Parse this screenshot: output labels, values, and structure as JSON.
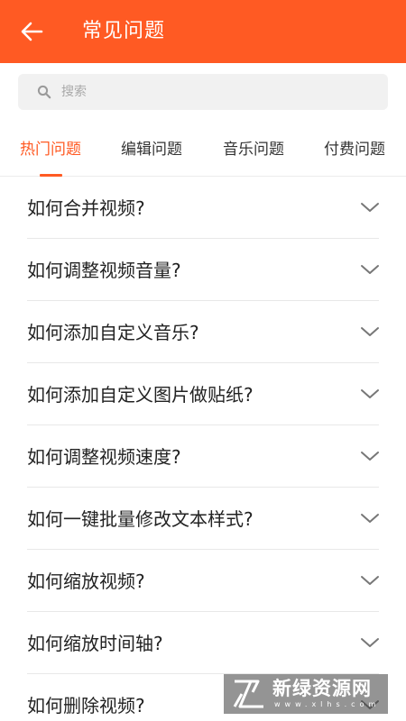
{
  "header": {
    "title": "常见问题",
    "back_icon": "arrow-left-icon",
    "background": "#ff5a23"
  },
  "search": {
    "placeholder": "搜索",
    "value": "",
    "icon": "search-icon"
  },
  "tabs": [
    {
      "label": "热门问题",
      "active": true
    },
    {
      "label": "编辑问题",
      "active": false
    },
    {
      "label": "音乐问题",
      "active": false
    },
    {
      "label": "付费问题",
      "active": false
    }
  ],
  "faq": {
    "items": [
      {
        "question": "如何合并视频?"
      },
      {
        "question": "如何调整视频音量?"
      },
      {
        "question": "如何添加自定义音乐?"
      },
      {
        "question": "如何添加自定义图片做贴纸?"
      },
      {
        "question": "如何调整视频速度?"
      },
      {
        "question": "如何一键批量修改文本样式?"
      },
      {
        "question": "如何缩放视频?"
      },
      {
        "question": "如何缩放时间轴?"
      },
      {
        "question": "如何删除视频?"
      }
    ],
    "expand_icon": "chevron-down-icon"
  },
  "watermark": {
    "text": "新绿资源网",
    "url": "www.xlhs.com"
  },
  "colors": {
    "accent": "#ff5a23",
    "text": "#222222",
    "divider": "#e8e8e8"
  }
}
